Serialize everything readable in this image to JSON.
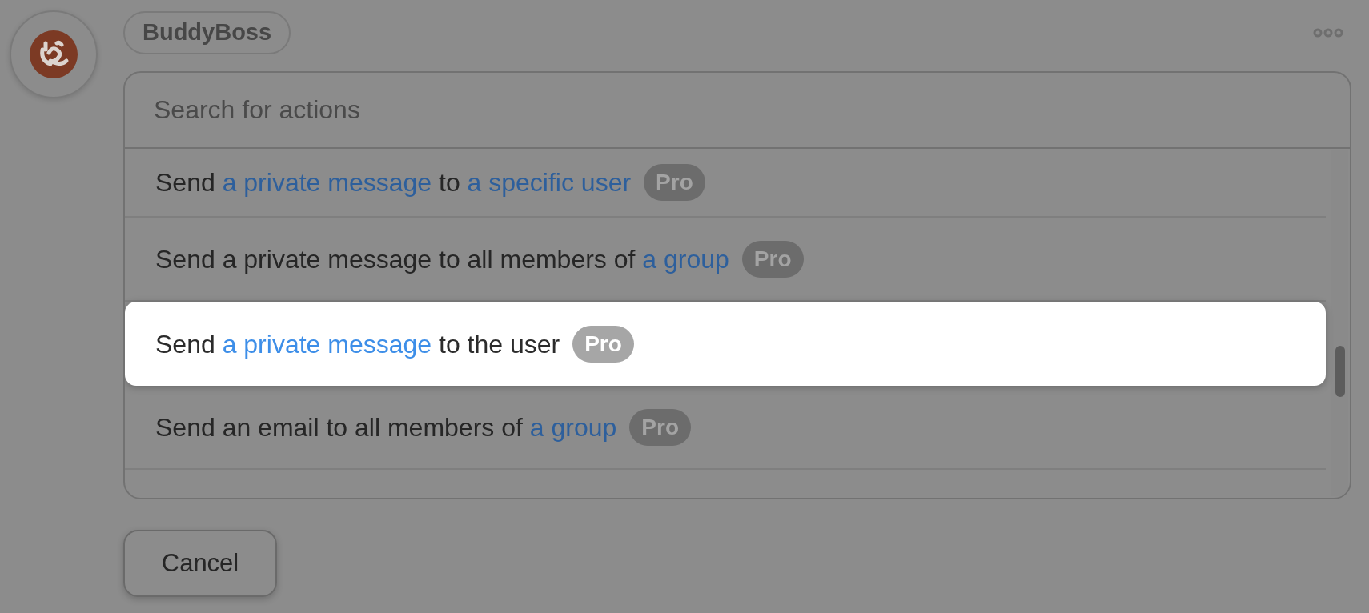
{
  "app_name": "BuddyBoss",
  "search": {
    "placeholder": "Search for actions"
  },
  "actions": [
    {
      "segments": [
        {
          "kind": "plain",
          "text": "Send "
        },
        {
          "kind": "link",
          "text": "a private message"
        },
        {
          "kind": "plain",
          "text": " to "
        },
        {
          "kind": "link",
          "text": "a specific user"
        }
      ],
      "badge": "Pro",
      "selected": false
    },
    {
      "segments": [
        {
          "kind": "plain",
          "text": "Send a private message to all members of "
        },
        {
          "kind": "link",
          "text": "a group"
        }
      ],
      "badge": "Pro",
      "selected": false
    },
    {
      "segments": [
        {
          "kind": "plain",
          "text": "Send "
        },
        {
          "kind": "link",
          "text": "a private message"
        },
        {
          "kind": "plain",
          "text": " to the user"
        }
      ],
      "badge": "Pro",
      "selected": true
    },
    {
      "segments": [
        {
          "kind": "plain",
          "text": "Send an email to all members of "
        },
        {
          "kind": "link",
          "text": "a group"
        }
      ],
      "badge": "Pro",
      "selected": false
    }
  ],
  "cancel_button": "Cancel"
}
